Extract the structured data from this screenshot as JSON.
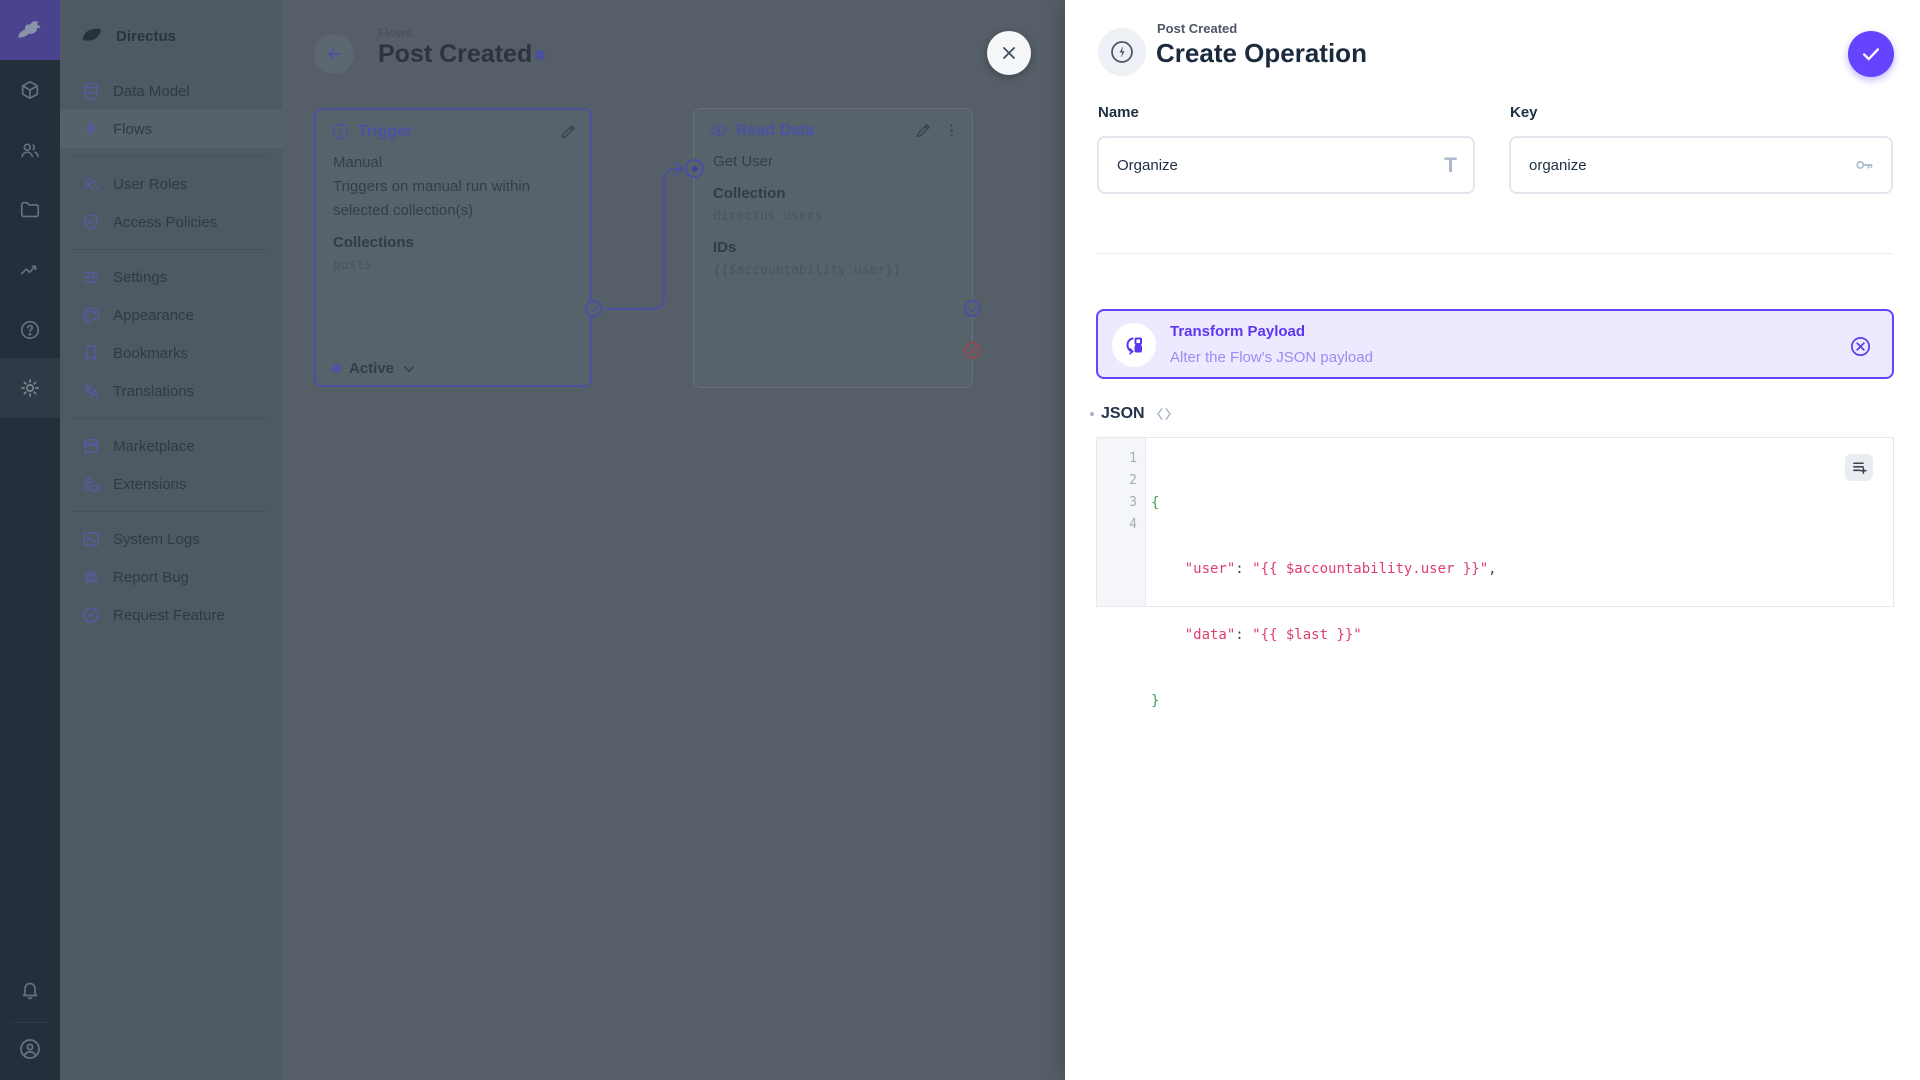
{
  "colors": {
    "accent": "#6644ff",
    "banner_bg": "#eee9ff",
    "code_string": "#de3f6c",
    "code_brace": "#3aa159",
    "status_dot": "#6644ff",
    "fail_red": "#e35169"
  },
  "sidebar": {
    "project": "Directus",
    "sections": [
      {
        "items": [
          {
            "label": "Data Model"
          },
          {
            "label": "Flows"
          }
        ]
      },
      {
        "items": [
          {
            "label": "User Roles"
          },
          {
            "label": "Access Policies"
          }
        ]
      },
      {
        "items": [
          {
            "label": "Settings"
          },
          {
            "label": "Appearance"
          },
          {
            "label": "Bookmarks"
          },
          {
            "label": "Translations"
          }
        ]
      },
      {
        "items": [
          {
            "label": "Marketplace"
          },
          {
            "label": "Extensions"
          }
        ]
      },
      {
        "items": [
          {
            "label": "System Logs"
          },
          {
            "label": "Report Bug"
          },
          {
            "label": "Request Feature"
          }
        ]
      }
    ]
  },
  "canvas": {
    "breadcrumb": "Flows",
    "title": "Post Created",
    "trigger": {
      "title": "Trigger",
      "type": "Manual",
      "description_line1": "Triggers on manual run within",
      "description_line2": "selected collection(s)",
      "collections_label": "Collections",
      "collections_value": "posts",
      "status": "Active"
    },
    "read_data": {
      "title": "Read Data",
      "name": "Get User",
      "collection_label": "Collection",
      "collection_value": "directus_users",
      "ids_label": "IDs",
      "ids_value": "{{$accountability.user}}"
    }
  },
  "drawer": {
    "eyebrow": "Post Created",
    "title": "Create Operation",
    "form": {
      "name_label": "Name",
      "name_value": "Organize",
      "key_label": "Key",
      "key_value": "organize"
    },
    "banner": {
      "title": "Transform Payload",
      "subtitle": "Alter the Flow's JSON payload"
    },
    "json_label": "JSON",
    "editor": {
      "lines": [
        {
          "num": "1",
          "tokens": [
            {
              "cls": "brace",
              "text": "{"
            }
          ]
        },
        {
          "num": "2",
          "tokens": [
            {
              "cls": "str",
              "text": "    \"user\""
            },
            {
              "cls": "pun",
              "text": ": "
            },
            {
              "cls": "str",
              "text": "\"{{ $accountability.user }}\""
            },
            {
              "cls": "pun",
              "text": ","
            }
          ]
        },
        {
          "num": "3",
          "tokens": [
            {
              "cls": "str",
              "text": "    \"data\""
            },
            {
              "cls": "pun",
              "text": ": "
            },
            {
              "cls": "str",
              "text": "\"{{ $last }}\""
            }
          ]
        },
        {
          "num": "4",
          "tokens": [
            {
              "cls": "brace",
              "text": "}"
            }
          ]
        }
      ]
    }
  }
}
